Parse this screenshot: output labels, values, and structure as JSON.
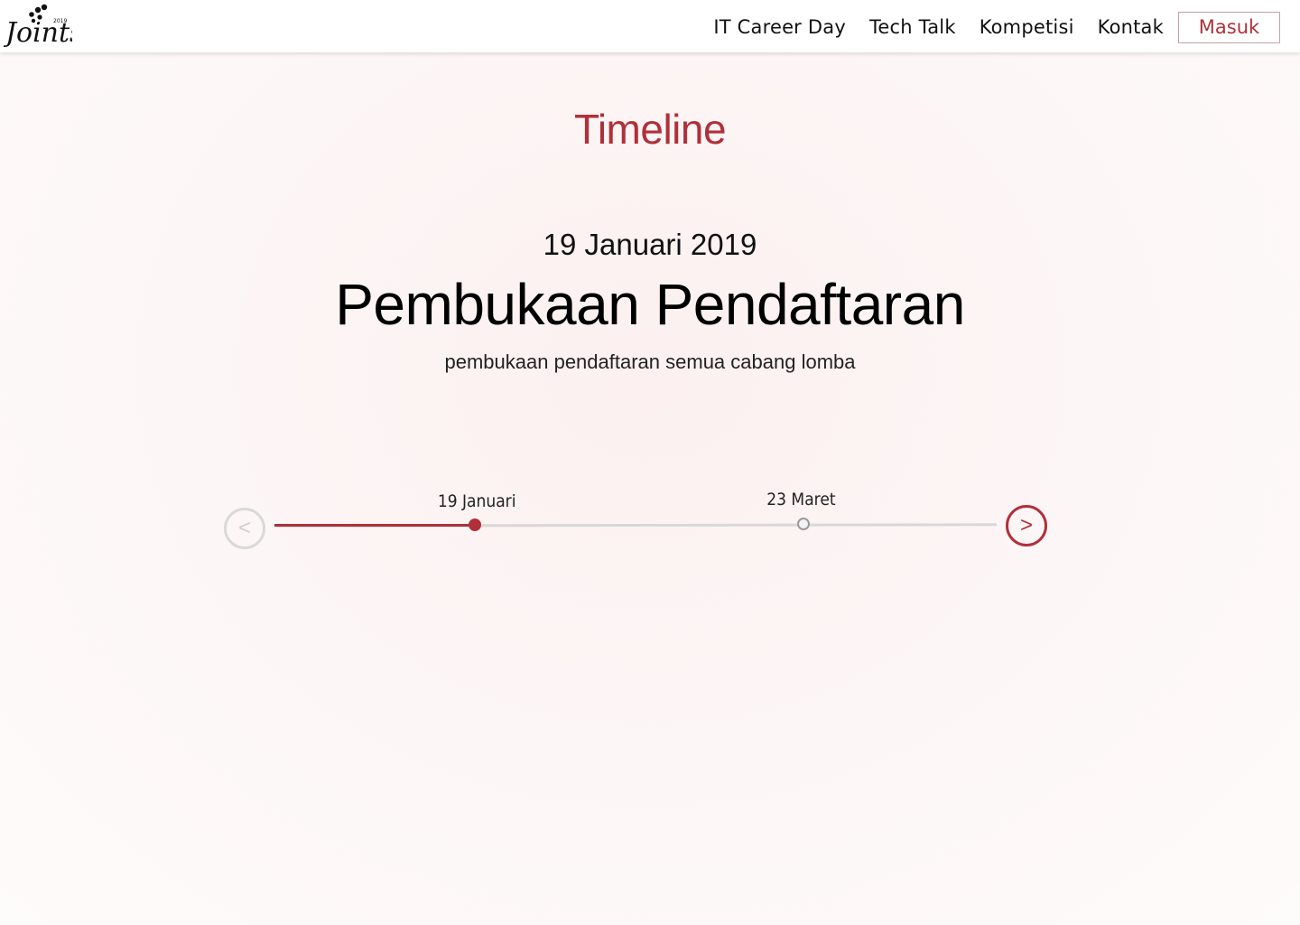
{
  "header": {
    "logo_text": "Joints",
    "logo_year": "2019",
    "nav": [
      {
        "label": "IT Career Day"
      },
      {
        "label": "Tech Talk"
      },
      {
        "label": "Kompetisi"
      },
      {
        "label": "Kontak"
      }
    ],
    "login_label": "Masuk"
  },
  "main": {
    "section_title": "Timeline",
    "current_event": {
      "date": "19 Januari 2019",
      "title": "Pembukaan Pendaftaran",
      "description": "pembukaan pendaftaran semua cabang lomba"
    },
    "timeline": {
      "prev_label": "<",
      "next_label": ">",
      "points": [
        {
          "label": "19 Januari",
          "active": true
        },
        {
          "label": "23 Maret",
          "active": false
        }
      ]
    }
  },
  "colors": {
    "accent": "#b0303a",
    "inactive": "#d8d8d8"
  }
}
